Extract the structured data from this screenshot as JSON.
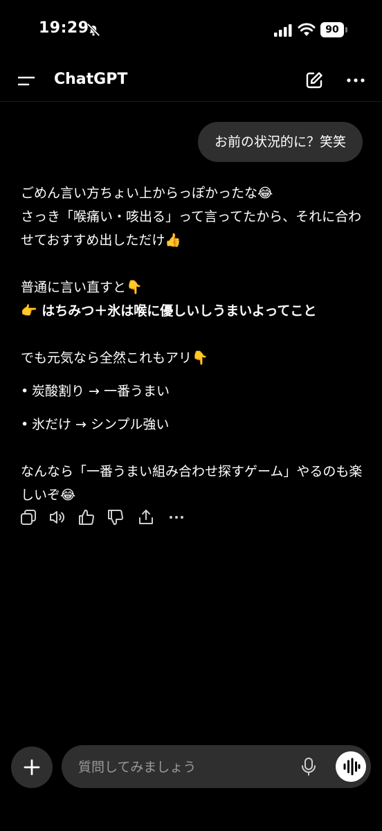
{
  "status_bar": {
    "time": "19:29",
    "battery": "90"
  },
  "header": {
    "title": "ChatGPT"
  },
  "user_message": "お前の状況的に？笑笑",
  "assistant": {
    "line1": "ごめん言い方ちょい上からっぽかったな😂",
    "line2": "さっき「喉痛い・咳出る」って言ってたから、それに合わせておすすめ出しただけ👍",
    "line3": "普通に言い直すと👇",
    "line4": "👉 はちみつ＋氷は喉に優しいしうまいよってこと",
    "line5": "でも元気なら全然これもアリ👇",
    "bullets": [
      "炭酸割り → 一番うまい",
      "氷だけ → シンプル強い"
    ],
    "line6": "なんなら「一番うまい組み合わせ探すゲーム」やるのも楽しいぞ😂"
  },
  "composer": {
    "placeholder": "質問してみましょう"
  },
  "icons": {
    "menu": "menu-icon",
    "compose": "compose-icon",
    "more": "more-icon",
    "copy": "copy-icon",
    "speaker": "speaker-icon",
    "thumbs_up": "thumbs-up-icon",
    "thumbs_down": "thumbs-down-icon",
    "share": "share-icon",
    "plus": "plus-icon",
    "mic": "mic-icon",
    "voice": "voice-waveform-icon"
  }
}
